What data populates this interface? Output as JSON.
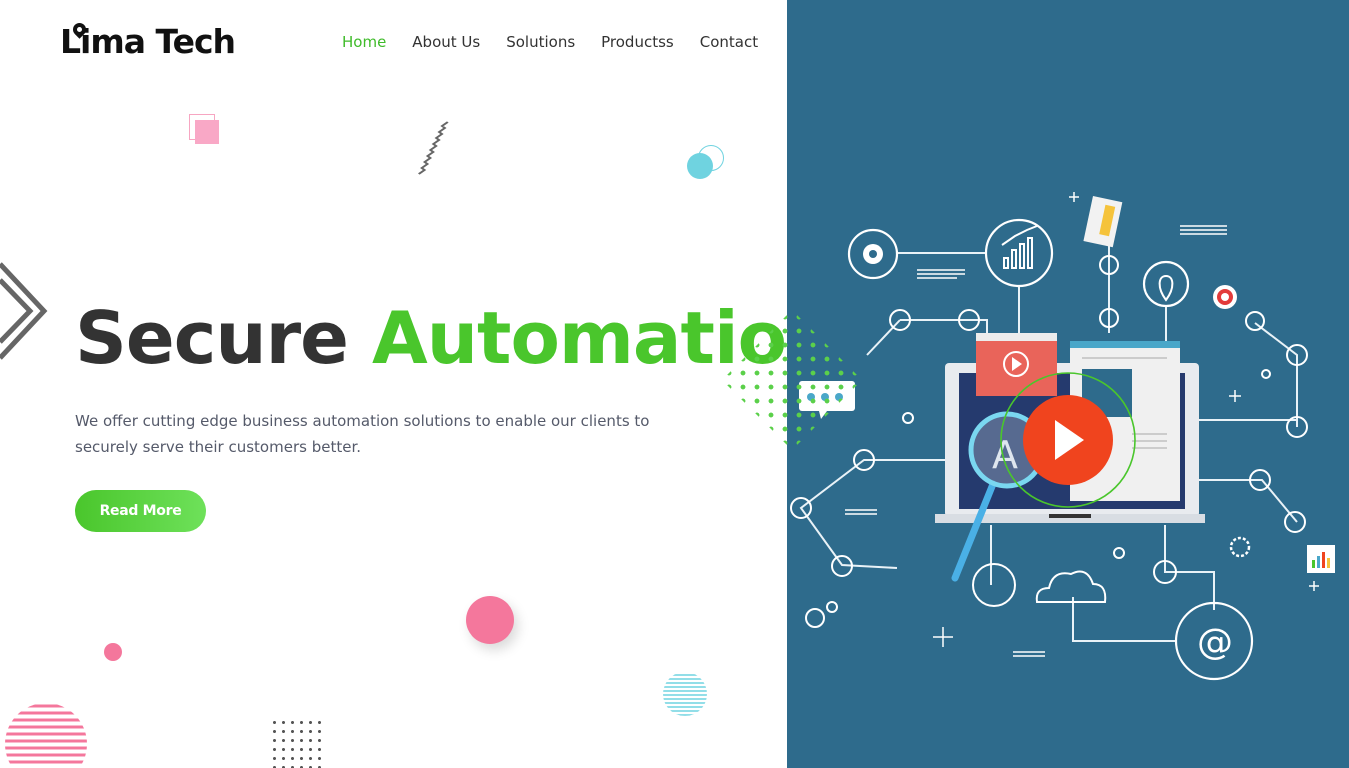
{
  "brand": {
    "name": "Lima Tech"
  },
  "nav": {
    "items": [
      {
        "label": "Home",
        "active": true
      },
      {
        "label": "About Us",
        "active": false
      },
      {
        "label": "Solutions",
        "active": false
      },
      {
        "label": "Productss",
        "active": false
      },
      {
        "label": "Contact",
        "active": false
      }
    ]
  },
  "hero": {
    "title_part1": "Secure",
    "title_part2": "Automation",
    "description": "We offer cutting edge business automation solutions to enable our clients to securely serve their customers better.",
    "button_label": "Read More"
  },
  "illustration": {
    "badge_text": "A",
    "at_symbol": "@"
  },
  "colors": {
    "accent": "#4ac62c",
    "panel": "#2e6b8c",
    "play": "#f0441e",
    "pink": "#f4779c",
    "cyan": "#6fd3e0"
  }
}
